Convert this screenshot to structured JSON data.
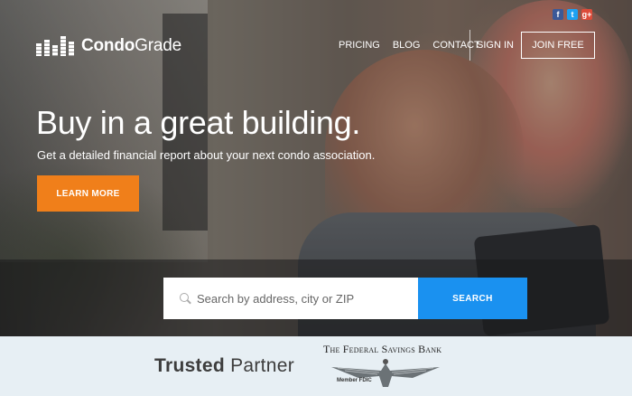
{
  "brand": {
    "logo_part1": "Condo",
    "logo_part2": "Grade"
  },
  "social": [
    {
      "icon": "facebook-icon",
      "glyph": "f"
    },
    {
      "icon": "twitter-icon",
      "glyph": "t"
    },
    {
      "icon": "google-plus-icon",
      "glyph": "g+"
    }
  ],
  "nav": {
    "items": [
      "PRICING",
      "BLOG",
      "CONTACT"
    ],
    "signin": "SIGN IN",
    "join": "JOIN FREE"
  },
  "hero": {
    "headline": "Buy in a great building.",
    "subhead": "Get a detailed financial report about your next condo association.",
    "cta": "LEARN MORE"
  },
  "search": {
    "placeholder": "Search by address, city or ZIP",
    "value": "",
    "button": "SEARCH"
  },
  "partner": {
    "label_bold": "Trusted",
    "label_rest": " Partner",
    "bank_name": "The Federal Savings Bank",
    "fdic": "Member FDIC"
  },
  "colors": {
    "cta_orange": "#f07f1a",
    "search_blue": "#1a91f0",
    "strip_bg": "#e7eff4"
  }
}
